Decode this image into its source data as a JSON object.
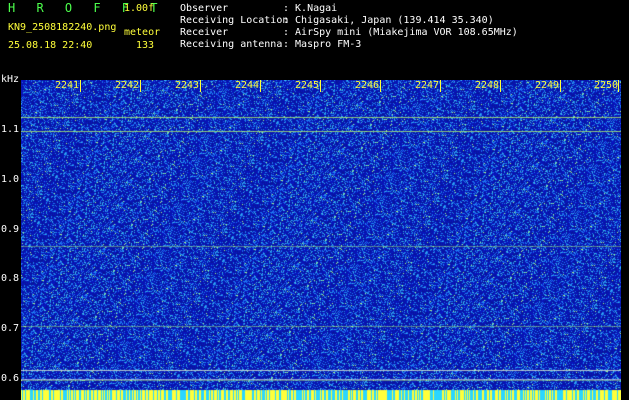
{
  "header": {
    "app_title": "H R O F F T",
    "version": "1.00f",
    "file_name": "KN9_2508182240.png",
    "mode": "meteor",
    "datetime": "25.08.18 22:40",
    "count": "133"
  },
  "info": [
    {
      "label": "Observer",
      "value": ": K.Nagai"
    },
    {
      "label": "Receiving Location",
      "value": ": Chigasaki, Japan (139.414 35.340)"
    },
    {
      "label": "Receiver",
      "value": ": AirSpy mini (Miakejima VOR 108.65MHz)"
    },
    {
      "label": "Receiving antenna",
      "value": ": Maspro FM-3"
    }
  ],
  "y_axis": {
    "unit": "kHz",
    "ticks": [
      "1.1",
      "1.0",
      "0.9",
      "0.8",
      "0.7",
      "0.6"
    ],
    "range": [
      0.58,
      1.19
    ]
  },
  "x_axis": {
    "ticks": [
      "2241",
      "2242",
      "2243",
      "2244",
      "2245",
      "2246",
      "2247",
      "2248",
      "2249",
      "2250"
    ]
  },
  "colors": {
    "background": "#000000",
    "label_green": "#4cff4c",
    "label_yellow": "#ffff3a",
    "spectrogram_base": "#0a1fa8",
    "spectrogram_noise": "#2a6cff",
    "signal": "#b9ff6a"
  },
  "spectrogram": {
    "horizontal_lines_khz": [
      1.12,
      1.095,
      0.865,
      0.71,
      0.62,
      0.6
    ],
    "vertical_markers": 10
  }
}
